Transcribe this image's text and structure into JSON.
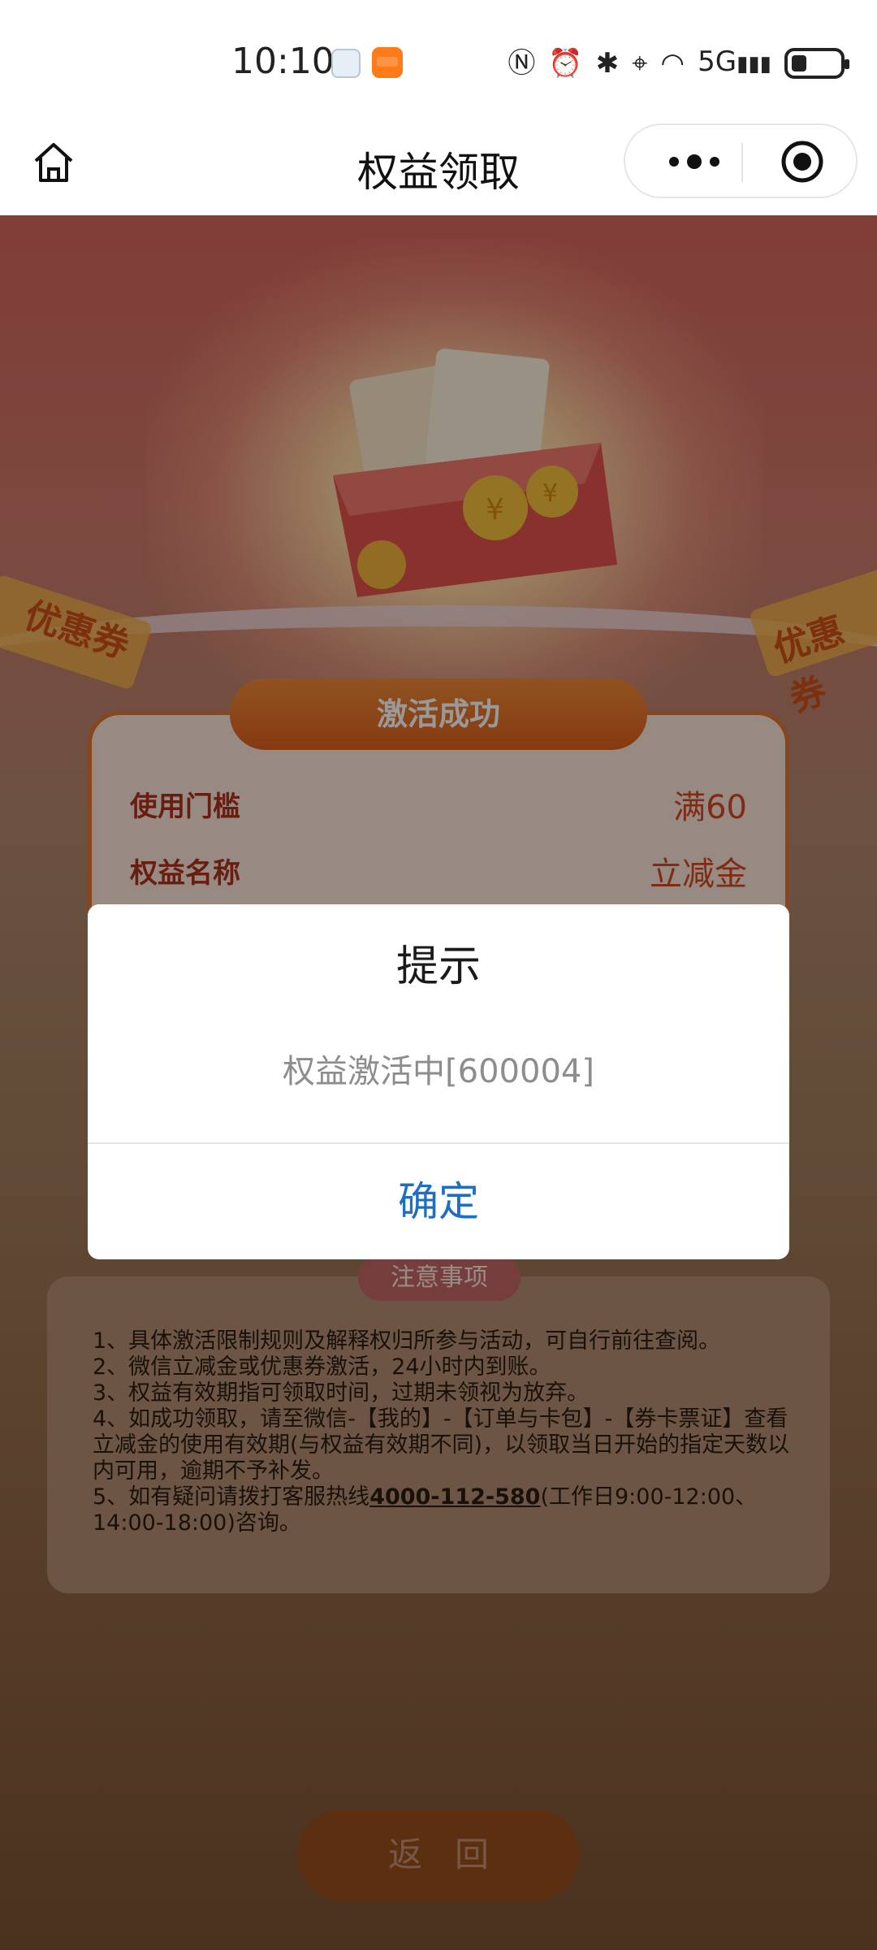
{
  "status_bar": {
    "time": "10:10",
    "network": "5G"
  },
  "nav": {
    "title": "权益领取"
  },
  "hero": {
    "tag_left": "优惠券",
    "tag_right": "优惠券"
  },
  "card": {
    "header": "激活成功",
    "rows": [
      {
        "label": "使用门槛",
        "value": "满60"
      },
      {
        "label": "权益名称",
        "value": "立减金"
      }
    ]
  },
  "notice": {
    "title": "注意事项",
    "items": [
      "1、具体激活限制规则及解释权归所参与活动，可自行前往查阅。",
      "2、微信立减金或优惠券激活，24小时内到账。",
      "3、权益有效期指可领取时间，过期未领视为放弃。",
      "4、如成功领取，请至微信-【我的】-【订单与卡包】-【券卡票证】查看立减金的使用有效期(与权益有效期不同)，以领取当日开始的指定天数以内可用，逾期不予补发。"
    ],
    "item5_prefix": "5、如有疑问请拨打客服热线",
    "hotline": "4000-112-580",
    "item5_suffix": "(工作日9:00-12:00、14:00-18:00)咨询。"
  },
  "back_button": "返回",
  "modal": {
    "title": "提示",
    "message": "权益激活中[600004]",
    "confirm": "确定"
  },
  "colors": {
    "accent_orange": "#e0611c",
    "confirm_blue": "#1d6fc3"
  }
}
